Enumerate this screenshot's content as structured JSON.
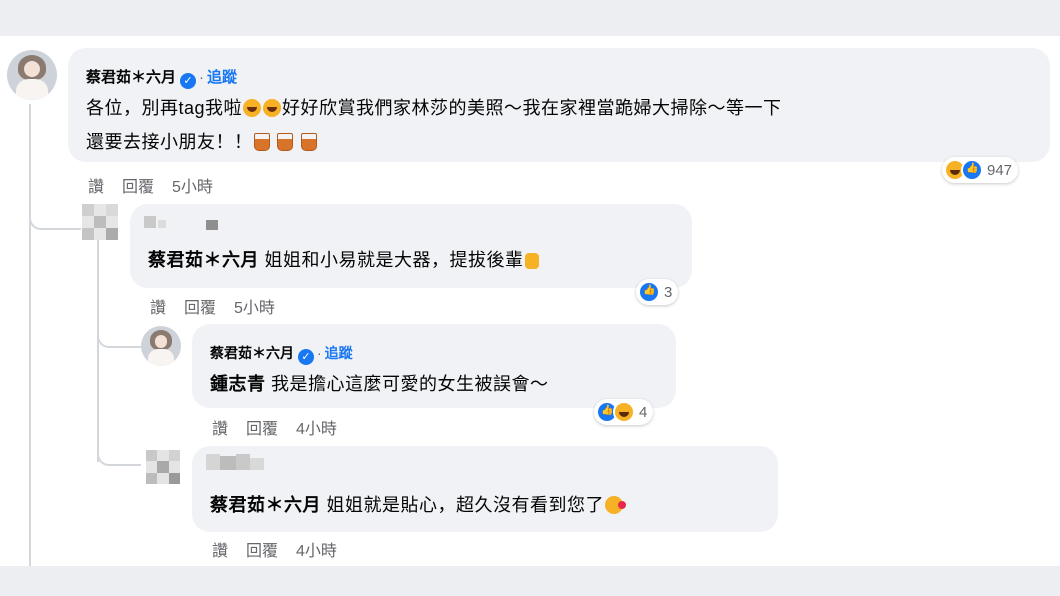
{
  "comments": [
    {
      "author": "蔡君茹＊六月",
      "verified": true,
      "follow_label": "追蹤",
      "text": "各位，別再tag我啦",
      "text_2": "好好欣賞我們家林莎的美照～我在家裡當跪婦大掃除～等一下",
      "text_3": "還要去接小朋友！！",
      "actions": {
        "like": "讚",
        "reply": "回覆",
        "time": "5小時"
      },
      "reactions": {
        "types": [
          "haha",
          "like"
        ],
        "count": "947"
      }
    },
    {
      "mention": "蔡君茹＊六月",
      "text": "姐姐和小易就是大器，提拔後輩",
      "actions": {
        "like": "讚",
        "reply": "回覆",
        "time": "5小時"
      },
      "reactions": {
        "types": [
          "like"
        ],
        "count": "3"
      }
    },
    {
      "author": "蔡君茹＊六月",
      "verified": true,
      "follow_label": "追蹤",
      "mention": "鍾志青",
      "text": "我是擔心這麼可愛的女生被誤會～",
      "actions": {
        "like": "讚",
        "reply": "回覆",
        "time": "4小時"
      },
      "reactions": {
        "types": [
          "like",
          "haha"
        ],
        "count": "4"
      }
    },
    {
      "mention": "蔡君茹＊六月",
      "text": "姐姐就是貼心，超久沒有看到您了",
      "actions": {
        "like": "讚",
        "reply": "回覆",
        "time": "4小時"
      }
    }
  ],
  "colors": {
    "bubble": "#f0f2f5",
    "link": "#1877f2",
    "meta": "#65676b",
    "band": "#eceef1"
  }
}
